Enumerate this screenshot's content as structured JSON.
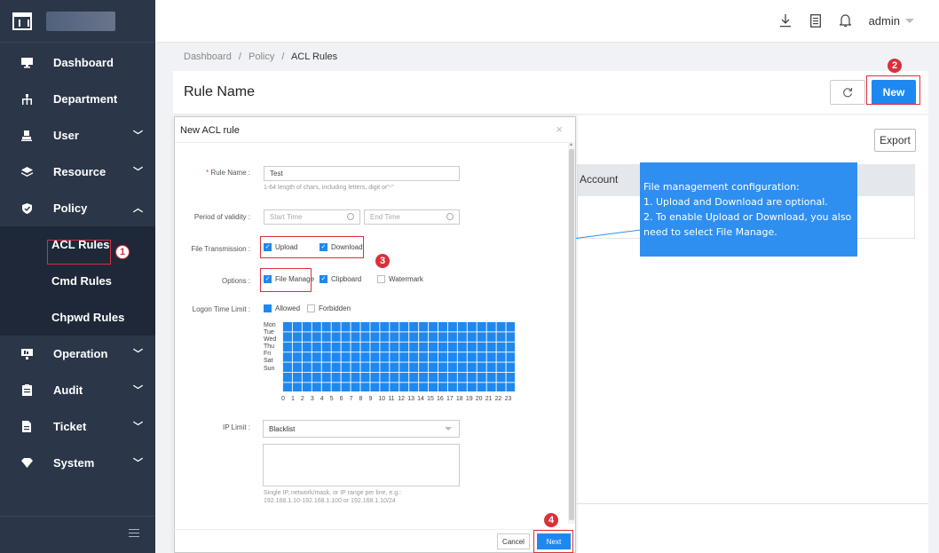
{
  "sidebar": {
    "items": [
      {
        "label": "Dashboard",
        "icon": "monitor-icon"
      },
      {
        "label": "Department",
        "icon": "org-tree-icon"
      },
      {
        "label": "User",
        "icon": "user-icon"
      },
      {
        "label": "Resource",
        "icon": "layers-icon"
      },
      {
        "label": "Policy",
        "icon": "shield-icon"
      },
      {
        "label": "Operation",
        "icon": "operation-icon"
      },
      {
        "label": "Audit",
        "icon": "clipboard-icon"
      },
      {
        "label": "Ticket",
        "icon": "ticket-icon"
      },
      {
        "label": "System",
        "icon": "system-icon"
      }
    ],
    "sub_items": [
      "ACL Rules",
      "Cmd Rules",
      "Chpwd Rules"
    ]
  },
  "header": {
    "user": "admin"
  },
  "breadcrumb": {
    "home": "Dashboard",
    "sep1": "/",
    "mid": "Policy",
    "sep2": "/",
    "current": "ACL Rules"
  },
  "page": {
    "title": "Rule Name",
    "new_label": "New",
    "export_label": "Export",
    "column_account": "Account"
  },
  "callout": {
    "line1": "File management configuration:",
    "line2": "1. Upload and Download are optional.",
    "line3": "2. To enable Upload or Download, you also",
    "line4": "need to select File Manage."
  },
  "badges": {
    "b1": "1",
    "b2": "2",
    "b3": "3",
    "b4": "4"
  },
  "modal": {
    "title": "New ACL rule",
    "close": "×",
    "rule_name_label": "Rule Name :",
    "rule_name_required": "*",
    "rule_name_value": "Test",
    "rule_name_hint": "1-64 length of chars, including letters, digit or\"-\"",
    "validity_label": "Period of validity :",
    "start_placeholder": "Start Time",
    "end_placeholder": "End Time",
    "file_transmission_label": "File Transmission :",
    "upload_label": "Upload",
    "download_label": "Download",
    "options_label": "Options :",
    "file_manage_label": "File Manage",
    "clipboard_label": "Clipboard",
    "watermark_label": "Watermark",
    "logon_label": "Logon Time Limit :",
    "allowed_label": "Allowed",
    "forbidden_label": "Forbidden",
    "days": [
      "Mon",
      "Tue",
      "Wed",
      "Thu",
      "Fri",
      "Sat",
      "Sun"
    ],
    "hours": [
      "0",
      "1",
      "2",
      "3",
      "4",
      "5",
      "6",
      "7",
      "8",
      "9",
      "10",
      "11",
      "12",
      "13",
      "14",
      "15",
      "16",
      "17",
      "18",
      "19",
      "20",
      "21",
      "22",
      "23"
    ],
    "ip_label": "IP Limit :",
    "ip_mode": "Blacklist",
    "ip_hint1": "Single IP, network/mask, or IP range per line, e.g.:",
    "ip_hint2": "192.168.1.10-192.168.1.100 or 192.168.1.10/24",
    "cancel_label": "Cancel",
    "next_label": "Next"
  },
  "colors": {
    "primary": "#1e88f0",
    "sidebar": "#2b3648",
    "highlight_border": "#d9303a",
    "callout": "#2f8ff0"
  }
}
